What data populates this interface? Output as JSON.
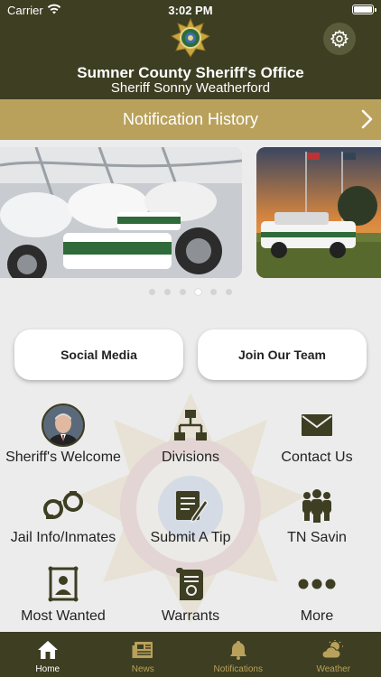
{
  "status_bar": {
    "carrier": "Carrier",
    "time": "3:02 PM"
  },
  "header": {
    "title": "Sumner County Sheriff's Office",
    "subtitle": "Sheriff Sonny Weatherford"
  },
  "notification_bar": {
    "label": "Notification History"
  },
  "carousel": {
    "slide_count": 6,
    "active_index": 3
  },
  "actions": {
    "social_media": "Social Media",
    "join_team": "Join Our Team"
  },
  "grid": {
    "sheriffs_welcome": "Sheriff's Welcome",
    "divisions": "Divisions",
    "contact_us": "Contact Us",
    "jail_info": "Jail Info/Inmates",
    "submit_tip": "Submit A Tip",
    "tn_savin": "TN Savin",
    "most_wanted": "Most Wanted",
    "warrants": "Warrants",
    "more": "More"
  },
  "tabs": [
    {
      "label": "Home"
    },
    {
      "label": "News"
    },
    {
      "label": "Notifications"
    },
    {
      "label": "Weather"
    }
  ],
  "colors": {
    "header": "#3d3e22",
    "accent": "#b9a15c",
    "background": "#ececec"
  }
}
